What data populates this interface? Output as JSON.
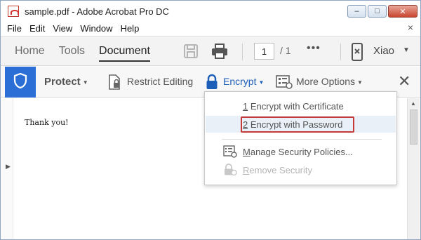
{
  "window": {
    "title": "sample.pdf - Adobe Acrobat Pro DC",
    "controls": {
      "minimize": "–",
      "maximize": "□",
      "close": "✕"
    }
  },
  "menubar": {
    "items": [
      "File",
      "Edit",
      "View",
      "Window",
      "Help"
    ],
    "close_doc": "×"
  },
  "toolbar": {
    "tabs": [
      "Home",
      "Tools",
      "Document"
    ],
    "active_tab": "Document",
    "page_current": "1",
    "page_total": "/ 1",
    "more": "•••",
    "user_name": "Xiao",
    "user_caret": "▼"
  },
  "protect_bar": {
    "protect_label": "Protect",
    "restrict_label": "Restrict Editing",
    "encrypt_label": "Encrypt",
    "more_options_label": "More Options",
    "caret": "▼",
    "close": "✕",
    "accent_color": "#2b6fd6"
  },
  "document": {
    "text": "Thank you!",
    "left_arrow": "▶",
    "scroll_up": "▲"
  },
  "encrypt_menu": {
    "items": [
      {
        "key": "1",
        "label": " Encrypt with Certificate"
      },
      {
        "key": "2",
        "label": " Encrypt with Password"
      },
      {
        "key": "M",
        "label": "anage Security Policies..."
      },
      {
        "key": "R",
        "label": "emove Security"
      }
    ],
    "highlighted_index": 1,
    "disabled_index": 3,
    "highlight_color": "#c43a3a"
  }
}
